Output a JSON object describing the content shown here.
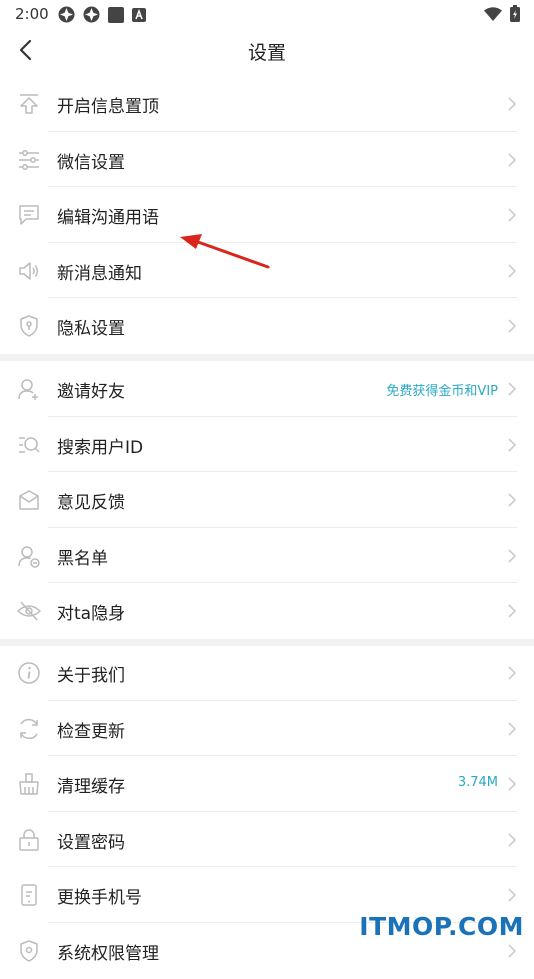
{
  "status_bar": {
    "time": "2:00"
  },
  "header": {
    "title": "设置"
  },
  "sections": [
    {
      "items": [
        {
          "label": "开启信息置顶",
          "icon": "pin-top-icon"
        },
        {
          "label": "微信设置",
          "icon": "sliders-icon"
        },
        {
          "label": "编辑沟通用语",
          "icon": "message-icon"
        },
        {
          "label": "新消息通知",
          "icon": "speaker-icon"
        },
        {
          "label": "隐私设置",
          "icon": "shield-icon"
        }
      ]
    },
    {
      "items": [
        {
          "label": "邀请好友",
          "icon": "user-add-icon",
          "extra": "免费获得金币和VIP"
        },
        {
          "label": "搜索用户ID",
          "icon": "search-user-icon"
        },
        {
          "label": "意见反馈",
          "icon": "feedback-icon"
        },
        {
          "label": "黑名单",
          "icon": "blacklist-icon"
        },
        {
          "label": "对ta隐身",
          "icon": "eye-hidden-icon"
        }
      ]
    },
    {
      "items": [
        {
          "label": "关于我们",
          "icon": "info-icon"
        },
        {
          "label": "检查更新",
          "icon": "refresh-icon"
        },
        {
          "label": "清理缓存",
          "icon": "broom-icon",
          "extra": "3.74M"
        },
        {
          "label": "设置密码",
          "icon": "lock-icon"
        },
        {
          "label": "更换手机号",
          "icon": "phone-icon"
        },
        {
          "label": "系统权限管理",
          "icon": "permission-icon"
        }
      ]
    }
  ],
  "watermark": "ITMOP.COM",
  "colors": {
    "accent": "#2aa9c5",
    "arrow": "#d9261c",
    "watermark": "#1a72b8"
  }
}
